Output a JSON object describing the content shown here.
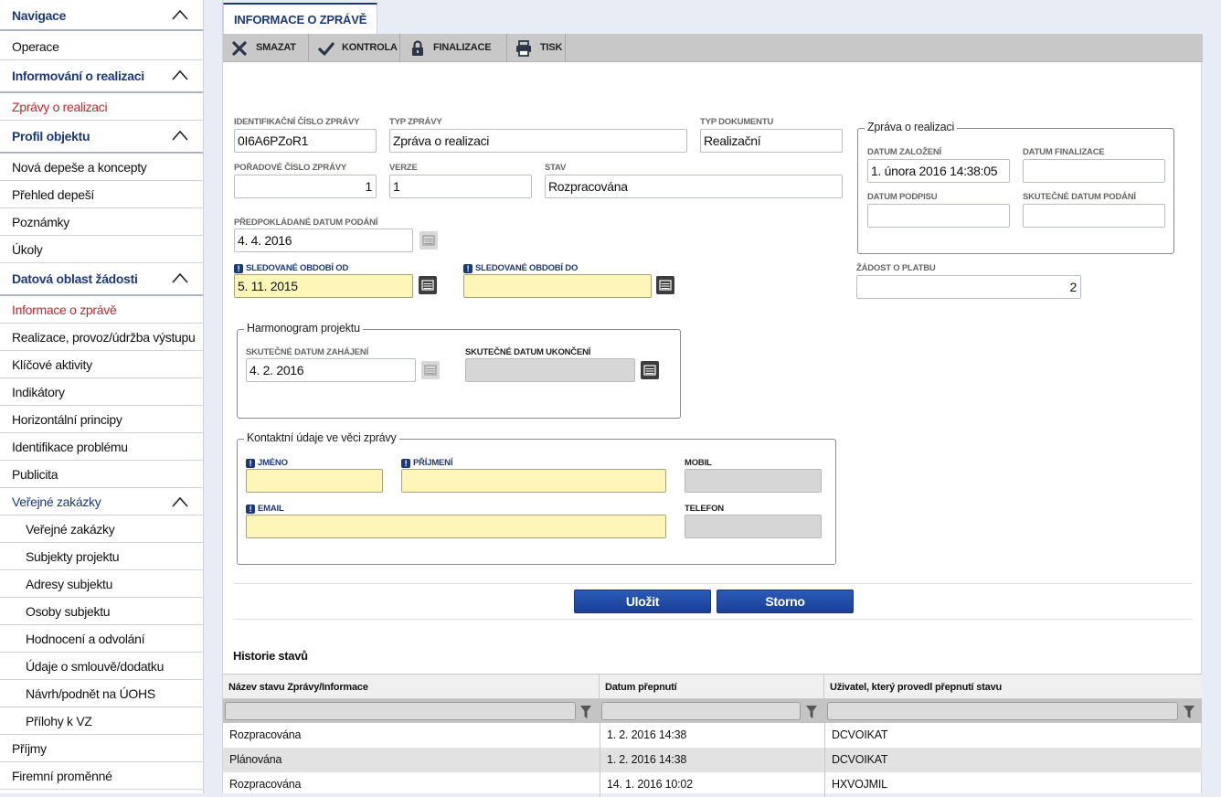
{
  "sidebar": {
    "navigace": "Navigace",
    "operace": "Operace",
    "informovani": "Informování o realizaci",
    "zpravy": "Zprávy o realizaci",
    "profil": "Profil objektu",
    "nova_depese": "Nová depeše a koncepty",
    "prehled_depesi": "Přehled depeší",
    "poznamky": "Poznámky",
    "ukoly": "Úkoly",
    "datova_oblast": "Datová oblast žádosti",
    "informace_o_zprave": "Informace o zprávě",
    "realizace": "Realizace, provoz/údržba výstupu",
    "klicove": "Klíčové aktivity",
    "indikatory": "Indikátory",
    "horizontalni": "Horizontální principy",
    "identifikace": "Identifikace problému",
    "publicita": "Publicita",
    "verejne_head": "Veřejné zakázky",
    "verejne_zakazky": "Veřejné zakázky",
    "subjekty": "Subjekty projektu",
    "adresy": "Adresy subjektu",
    "osoby": "Osoby subjektu",
    "hodnoceni": "Hodnocení a odvolání",
    "udaje": "Údaje o smlouvě/dodatku",
    "navrh": "Návrh/podnět na ÚOHS",
    "prilohy": "Přílohy k VZ",
    "prijmy": "Příjmy",
    "firemni": "Firemní proměnné"
  },
  "tab": {
    "label": "INFORMACE O ZPRÁVĚ"
  },
  "toolbar": {
    "smazat": "SMAZAT",
    "kontrola": "KONTROLA",
    "finalizace": "FINALIZACE",
    "tisk": "TISK"
  },
  "form": {
    "id_label": "IDENTIFIKAČNÍ ČÍSLO ZPRÁVY",
    "id_value": "0I6A6PZoR1",
    "typ_zpravy_label": "TYP ZPRÁVY",
    "typ_zpravy_value": "Zpráva o realizaci",
    "typ_dokumentu_label": "TYP DOKUMENTU",
    "typ_dokumentu_value": "Realizační",
    "poradove_label": "POŘADOVÉ ČÍSLO ZPRÁVY",
    "poradove_value": "1",
    "verze_label": "VERZE",
    "verze_value": "1",
    "stav_label": "STAV",
    "stav_value": "Rozpracována",
    "predpokladane_label": "PŘEDPOKLÁDANÉ DATUM PODÁNÍ",
    "predpokladane_value": "4. 4. 2016",
    "obdobi_od_label": "SLEDOVANÉ OBDOBÍ OD",
    "obdobi_od_value": "5. 11. 2015",
    "obdobi_do_label": "SLEDOVANÉ OBDOBÍ DO",
    "obdobi_do_value": "",
    "zprava_group": "Zpráva o realizaci",
    "datum_zalozeni_label": "DATUM ZALOŽENÍ",
    "datum_zalozeni_value": "1. února 2016 14:38:05",
    "datum_finalizace_label": "DATUM FINALIZACE",
    "datum_finalizace_value": "",
    "datum_podpisu_label": "DATUM PODPISU",
    "datum_podpisu_value": "",
    "skutecne_podani_label": "SKUTEČNÉ DATUM PODÁNÍ",
    "skutecne_podani_value": "",
    "zadost_label": "ŽÁDOST O PLATBU",
    "zadost_value": "2",
    "harmonogram_group": "Harmonogram projektu",
    "zahajeni_label": "SKUTEČNÉ DATUM ZAHÁJENÍ",
    "zahajeni_value": "4. 2. 2016",
    "ukonceni_label": "SKUTEČNÉ DATUM UKONČENÍ",
    "ukonceni_value": "",
    "kontakt_group": "Kontaktní údaje ve věci zprávy",
    "jmeno_label": "JMÉNO",
    "prijmeni_label": "PŘÍJMENÍ",
    "mobil_label": "MOBIL",
    "email_label": "EMAIL",
    "telefon_label": "TELEFON",
    "required_mark": "!",
    "ulozit": "Uložit",
    "storno": "Storno"
  },
  "history": {
    "title": "Historie stavů",
    "columns": [
      "Název stavu Zprávy/Informace",
      "Datum přepnutí",
      "Uživatel, který provedl přepnutí stavu"
    ],
    "rows": [
      [
        "Rozpracována",
        "1. 2. 2016 14:38",
        "DCVOIKAT"
      ],
      [
        "Plánována",
        "1. 2. 2016 14:38",
        "DCVOIKAT"
      ],
      [
        "Rozpracována",
        "14. 1. 2016 10:02",
        "HXVOJMIL"
      ]
    ]
  },
  "colors": {
    "navy": "#1c3a7a",
    "active_red": "#c0282d",
    "required_yellow": "#fdf6b8",
    "button_blue": "#1b3f95"
  }
}
